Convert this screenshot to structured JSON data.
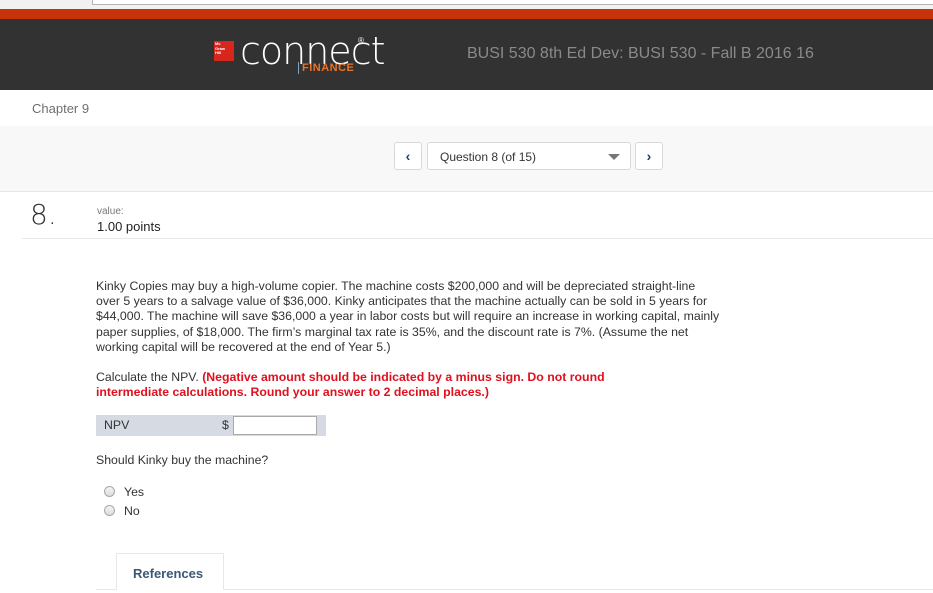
{
  "brand": {
    "publisher_logo": "McGraw Hill Education",
    "product": "connect",
    "registered_mark": "®",
    "subject": "FINANCE"
  },
  "course_title": "BUSI 530 8th Ed Dev: BUSI 530 - Fall B 2016 16",
  "chapter": "Chapter 9",
  "navigation": {
    "prev_icon": "‹",
    "next_icon": "›",
    "question_selector": "Question 8 (of 15)"
  },
  "question": {
    "number": "8.",
    "value_label": "value:",
    "points": "1.00 points",
    "problem_text": "Kinky Copies may buy a high-volume copier. The machine costs $200,000 and will be depreciated straight-line over 5 years to a salvage value of $36,000. Kinky anticipates that the machine actually can be sold in 5 years for $44,000. The machine will save $36,000 a year in labor costs but will require an increase in working capital, mainly paper supplies, of $18,000. The firm’s marginal tax rate is 35%, and the discount rate is 7%. (Assume the net working capital will be recovered at the end of Year 5.)",
    "instruction_plain": "Calculate the NPV. ",
    "instruction_red": "(Negative amount should be indicated by a minus sign. Do not round intermediate calculations. Round your answer to 2 decimal places.)",
    "npv_label": "NPV",
    "currency_symbol": "$",
    "npv_value": "",
    "followup_question": "Should Kinky buy the machine?",
    "options": [
      {
        "label": "Yes",
        "selected": false
      },
      {
        "label": "No",
        "selected": false
      }
    ]
  },
  "references_tab": "References",
  "colors": {
    "accent_red": "#c8340a",
    "header_dark": "#323232",
    "instruction_red": "#e0101e",
    "finance_orange": "#e8742a"
  }
}
